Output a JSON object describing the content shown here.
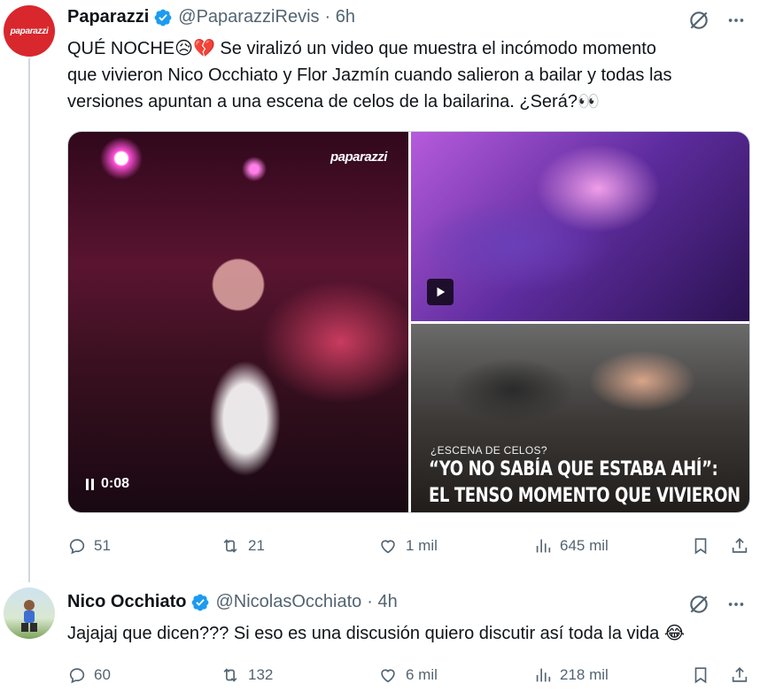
{
  "tweet1": {
    "avatar_text": "paparazzi",
    "name": "Paparazzi",
    "handle": "@PaparazziRevis",
    "time": "· 6h",
    "text_line1": "QUÉ NOCHE😥💔 Se viralizó un video que muestra el incómodo momento",
    "text_line2": "que vivieron Nico Occhiato y Flor Jazmín cuando salieron a bailar y todas las",
    "text_line3": "versiones apuntan a una escena de celos de la bailarina. ¿Será?👀",
    "media": {
      "watermark": "paparazzi",
      "video_time": "0:08",
      "overlay_kicker": "¿ESCENA DE CELOS?",
      "overlay_head1": "“YO NO SABÍA QUE ESTABA AHÍ”:",
      "overlay_head2": "EL TENSO MOMENTO QUE VIVIERON"
    },
    "stats": {
      "replies": "51",
      "retweets": "21",
      "likes": "1 mil",
      "views": "645 mil"
    }
  },
  "tweet2": {
    "name": "Nico Occhiato",
    "handle": "@NicolasOcchiato",
    "time": "· 4h",
    "text": "Jajajaj que dicen??? Si eso es una discusión quiero discutir así toda la vida 😂",
    "stats": {
      "replies": "60",
      "retweets": "132",
      "likes": "6 mil",
      "views": "218 mil"
    }
  },
  "colors": {
    "verified": "#1d9bf0",
    "muted": "#536471",
    "text": "#0f1419",
    "thread_line": "#cfd9de",
    "avatar_red": "#d8272d"
  },
  "icons": [
    "verified-icon",
    "grok-icon",
    "more-icon",
    "reply-icon",
    "retweet-icon",
    "like-icon",
    "views-icon",
    "bookmark-icon",
    "share-icon",
    "pause-icon",
    "play-icon"
  ]
}
